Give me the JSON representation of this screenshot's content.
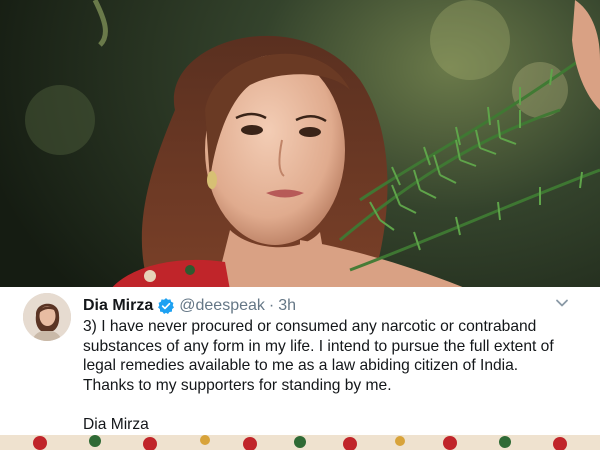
{
  "tweet": {
    "display_name": "Dia Mirza",
    "handle": "@deespeak",
    "separator": "·",
    "time": "3h",
    "body_lines": [
      "3) I have never procured or consumed any narcotic or contraband",
      "substances of any form in my life. I intend to pursue the full extent of",
      "legal remedies available to me as a law abiding citizen of India.",
      "Thanks to my supporters for standing by me."
    ],
    "signature": "Dia Mirza"
  },
  "icons": {
    "verified": "verified-badge-icon",
    "menu": "chevron-down-icon"
  },
  "colors": {
    "verified_blue": "#1da1f2",
    "text": "#14171a",
    "secondary": "#657786",
    "dress_red": "#c0252a"
  }
}
